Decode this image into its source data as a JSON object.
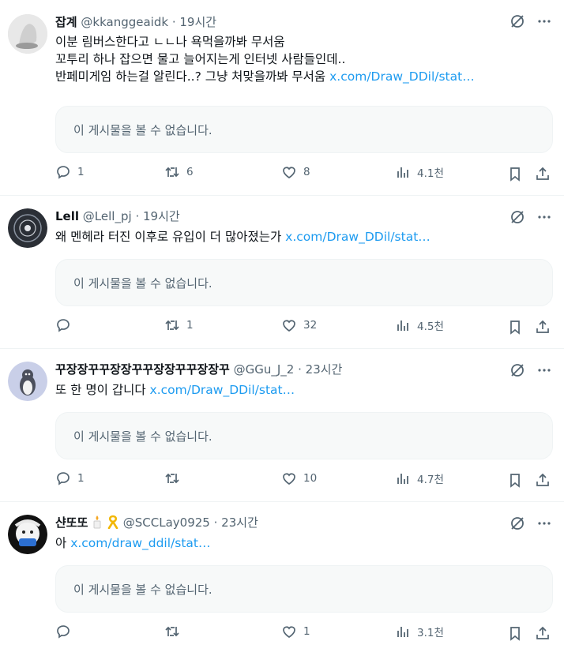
{
  "embed_unavailable": "이 게시물을 볼 수 없습니다.",
  "tweets": [
    {
      "name": "잡계",
      "handle": "@kkanggeaidk",
      "dot": "·",
      "time": "19시간",
      "lines": [
        "이분 림버스한다고 ㄴㄴ나 욕먹을까봐 무서움",
        "꼬투리 하나 잡으면 물고 늘어지는게 인터넷 사람들인데..",
        "반페미게임 하는걸 알린다..? 그냥 처맞을까봐 무서움 "
      ],
      "link": "x.com/Draw_DDil/stat…",
      "replies": "1",
      "reposts": "6",
      "likes": "8",
      "views": "4.1천"
    },
    {
      "name": "Lell",
      "handle": "@Lell_pj",
      "dot": "·",
      "time": "19시간",
      "lines": [
        "왜 멘헤라 터진 이후로 유입이 더 많아졌는가 "
      ],
      "link": "x.com/Draw_DDil/stat…",
      "replies": "",
      "reposts": "1",
      "likes": "32",
      "views": "4.5천"
    },
    {
      "name": "꾸장장꾸꾸장장꾸꾸장장꾸꾸장장꾸",
      "handle": "@GGu_J_2",
      "dot": "·",
      "time": "23시간",
      "lines": [
        "또 한 명이 갑니다 "
      ],
      "link": "x.com/Draw_DDil/stat…",
      "replies": "1",
      "reposts": "",
      "likes": "10",
      "views": "4.7천"
    },
    {
      "name": "샨또또",
      "handle": "@SCCLay0925",
      "dot": "·",
      "time": "23시간",
      "lines": [
        "아 "
      ],
      "link": "x.com/draw_ddil/stat…",
      "replies": "",
      "reposts": "",
      "likes": "1",
      "views": "3.1천"
    }
  ],
  "colors": {
    "link": "#1d9bf0",
    "muted": "#536471",
    "embed_bg": "#f7f9f9"
  }
}
